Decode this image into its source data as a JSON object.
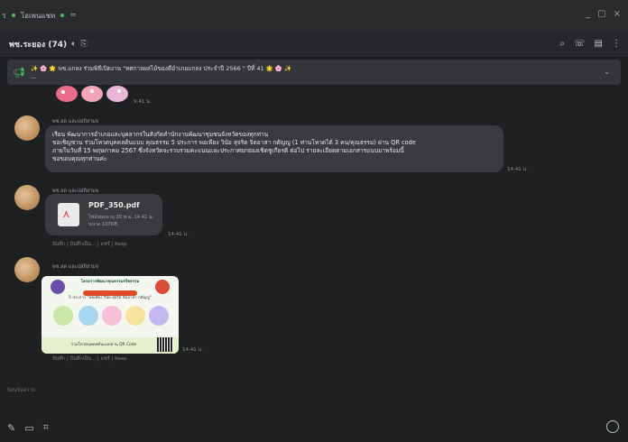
{
  "titlebar": {
    "app_label": "ร",
    "tab_label": "โอเพนแชท",
    "tab_icon": "sliders-icon",
    "controls": [
      "_",
      "▢",
      "×"
    ]
  },
  "chat_header": {
    "title": "พช.ระยอง (74)",
    "icons": [
      "mute-icon",
      "link-icon"
    ],
    "right_icons": [
      "search-icon",
      "call-icon",
      "notes-icon",
      "more-icon"
    ]
  },
  "announcement": {
    "text": "✨ 🌸 🌟 พช.แกลง ร่วมพิธีเปิดงาน \"ทศกาลผลไม้ของดีอำเภอแกลง ประจำปี 2566 \" ปีที่ 41 🌟 🌸 ✨",
    "text2": "..."
  },
  "sticker": {
    "time": "9.41 น."
  },
  "messages": [
    {
      "sender": "พช.ลด และปสถิสามจ",
      "lines": [
        "เรียน พัฒนาการอำเภอและบุคลากรในสังกัดสำนักงานพัฒนาชุมชนจังหวัดของทุกท่าน",
        "      ขอเชิญชวน ร่วมโหวตบุคคลต้นแบบ คุณธรรม 5 ประการ พอเพียง วินัย สุจริต จิตอาสา กตัญญู  (1 ท่านโหวตได้ 3 คน/คุณธรรม) ผ่าน QR code",
        "ภายในวันที่ 15 พฤษภาคม 2567 ซึ่งจังหวัดจะรวบรวมคะแนนและประกาศยกย่องเชิดชูเกียรติ ต่อไป รายละเอียดตามเอกสารแนบมาพร้อมนี้",
        "ขอขอบคุณทุกท่านค่ะ"
      ],
      "time": "14.41 น."
    },
    {
      "sender": "พช.ลด และปสถิสามจ",
      "file_name": "PDF_350.pdf",
      "file_expiry": "ไฟล์หมดอายุ 20 พ.ค. 14.41 น.",
      "file_size": "ขนาด 107KB",
      "time": "14.41 น.",
      "actions": "บันทึก | บันทึกเป็น... | แชร์ | Keep"
    },
    {
      "sender": "พช.ลด และปสถิสามจ",
      "poster_title": "โครงการพัฒนาคุณธรรมจริยธรรม",
      "poster_sub": "5 ประการ \"พอเพียง วินัย สุจริต จิตอาสา กตัญญู\"",
      "poster_footer": "ร่วมโหวตบุคคลต้นแบบผ่าน QR Code",
      "time": "14.41 น.",
      "actions": "บันทึก | บันทึกเป็น... | แชร์ | Keep"
    }
  ],
  "composer": {
    "placeholder": "ป้อนข้อความ",
    "icons": [
      "attach-icon",
      "sticker-icon",
      "crop-icon",
      "emoji-icon"
    ]
  }
}
